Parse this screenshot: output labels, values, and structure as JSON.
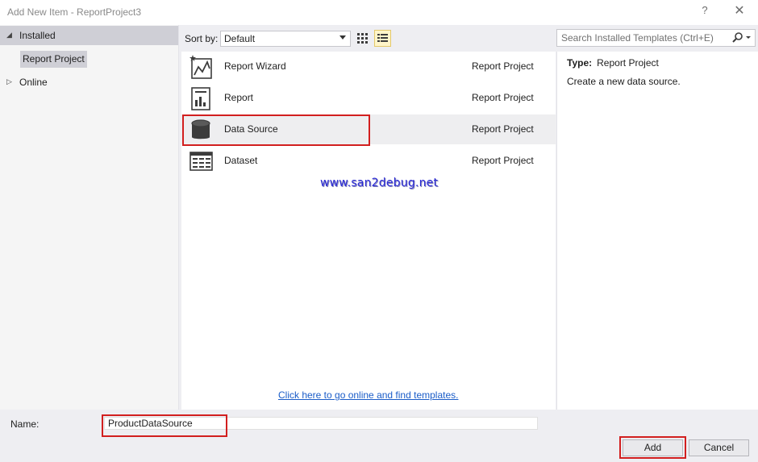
{
  "window": {
    "title": "Add New Item - ReportProject3",
    "help_glyph": "?",
    "close_glyph": "✕"
  },
  "tree": {
    "installed_label": "Installed",
    "installed_child_label": "Report Project",
    "online_label": "Online"
  },
  "toolbar": {
    "sort_label": "Sort by:",
    "sort_value": "Default",
    "search_placeholder": "Search Installed Templates (Ctrl+E)"
  },
  "templates": [
    {
      "name": "Report Wizard",
      "category": "Report Project",
      "icon": "report-wizard-icon"
    },
    {
      "name": "Report",
      "category": "Report Project",
      "icon": "report-icon"
    },
    {
      "name": "Data Source",
      "category": "Report Project",
      "icon": "database-icon",
      "selected": true
    },
    {
      "name": "Dataset",
      "category": "Report Project",
      "icon": "dataset-icon"
    }
  ],
  "watermark": "www.san2debug.net",
  "online_link": "Click here to go online and find templates.",
  "details": {
    "type_label": "Type:",
    "type_value": "Report Project",
    "description": "Create a new data source."
  },
  "footer": {
    "name_label": "Name:",
    "name_value": "ProductDataSource",
    "add_label": "Add",
    "cancel_label": "Cancel"
  },
  "colors": {
    "highlight": "#d21f1f",
    "link": "#1a5cc8",
    "watermark": "#2b2bd6"
  }
}
